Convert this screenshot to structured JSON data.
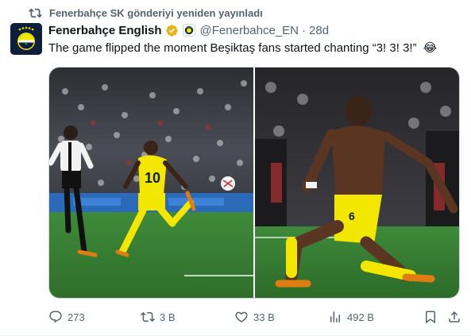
{
  "repost": {
    "label": "Fenerbahçe SK gönderiyi yeniden yayınladı"
  },
  "author": {
    "name": "Fenerbahçe English",
    "handle": "@Fenerbahce_EN",
    "time": "28d"
  },
  "tweet": {
    "text": "The game flipped the moment Beşiktaş fans started chanting “3! 3! 3!”",
    "emoji": "😂"
  },
  "media": {
    "left": {
      "jersey_number": "10"
    },
    "right": {
      "jersey_number": "6"
    }
  },
  "actions": {
    "replies": "273",
    "reposts": "3 B",
    "likes": "33 B",
    "views": "492 B"
  },
  "colors": {
    "text": "#0f1419",
    "muted": "#536471",
    "verified": "#e2b719",
    "border": "#cfd9de",
    "fenerbahce_yellow": "#f3e600",
    "fenerbahce_navy": "#0d1f3c"
  },
  "icons": [
    "repost-icon",
    "verified-badge-icon",
    "affiliate-badge-icon",
    "reply-icon",
    "like-icon",
    "views-icon",
    "bookmark-icon",
    "share-icon"
  ]
}
